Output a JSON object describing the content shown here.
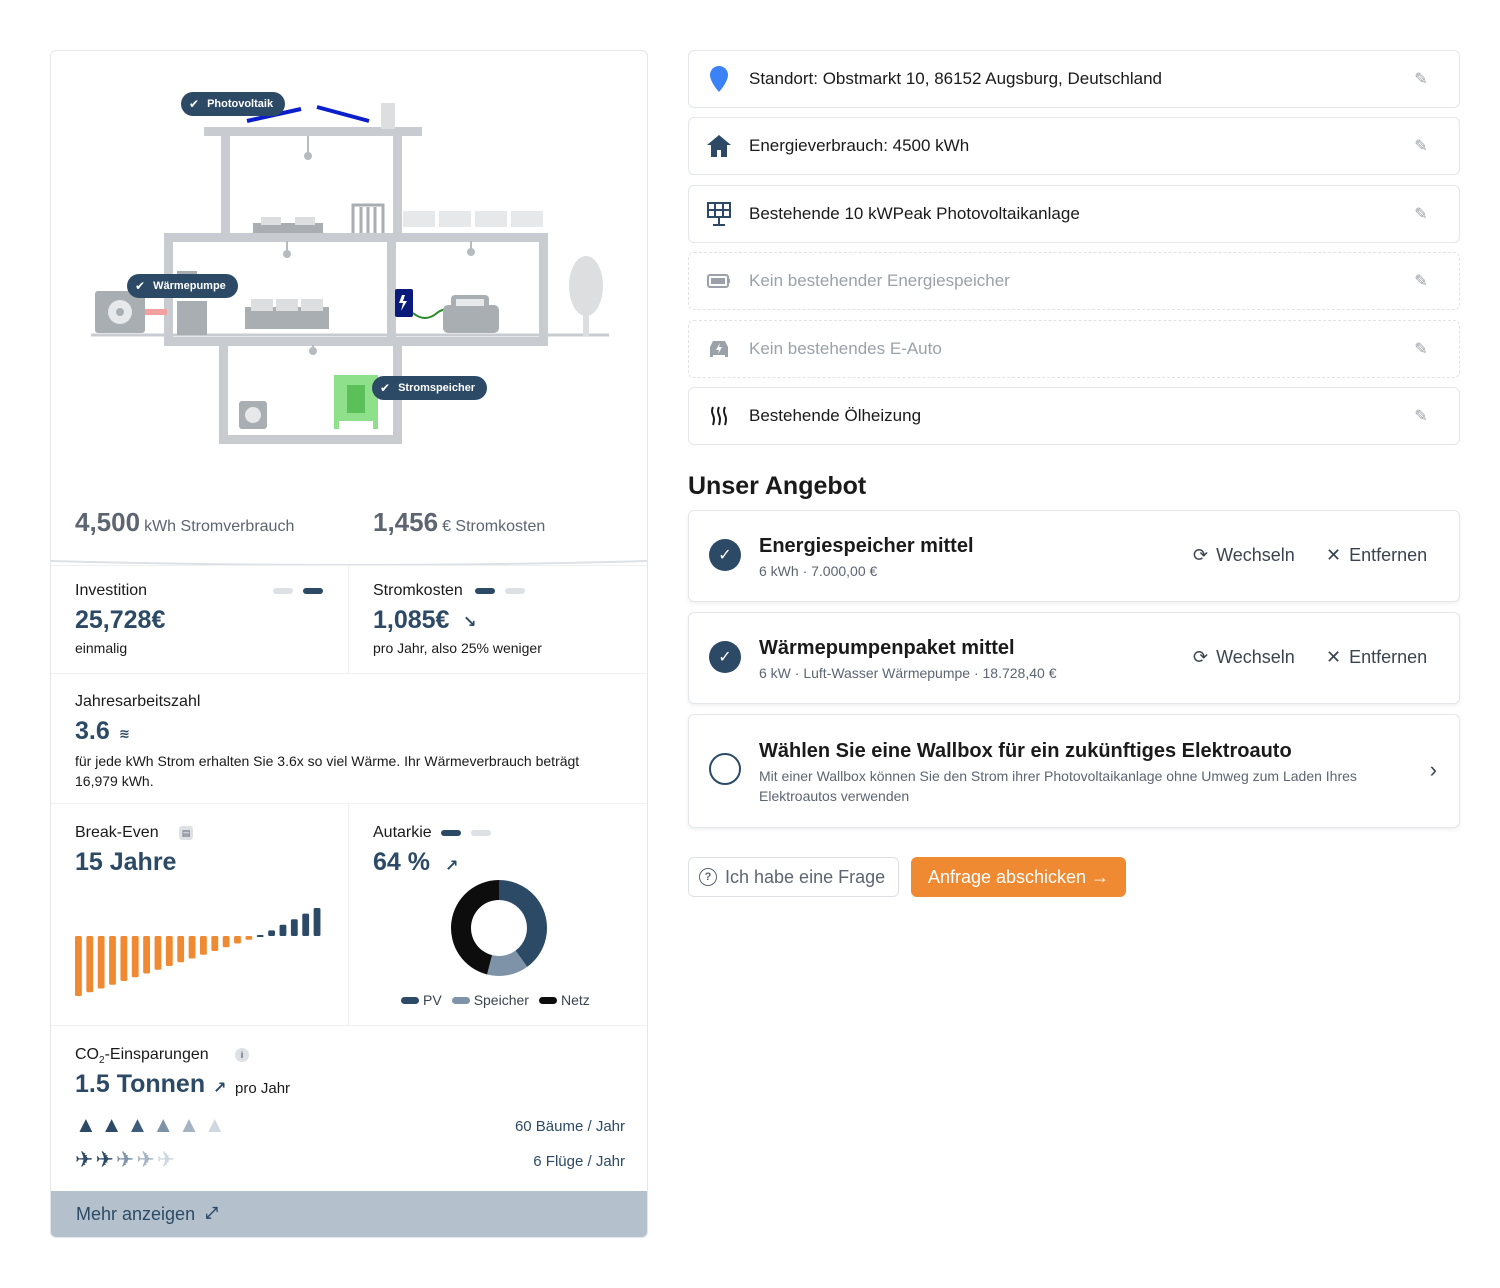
{
  "house": {
    "tags": {
      "photovoltaik": "Photovoltaik",
      "waermepumpe": "Wärmepumpe",
      "stromspeicher": "Stromspeicher"
    }
  },
  "top_stats": {
    "consumption_value": "4,500",
    "consumption_unit": "kWh Stromverbrauch",
    "cost_value": "1,456",
    "cost_unit": "€ Stromkosten"
  },
  "investition": {
    "label": "Investition",
    "value": "25,728€",
    "sub": "einmalig"
  },
  "stromkosten": {
    "label": "Stromkosten",
    "value": "1,085€",
    "sub": "pro Jahr, also 25% weniger"
  },
  "jaz": {
    "label": "Jahresarbeitszahl",
    "value": "3.6",
    "sub": "für jede kWh Strom erhalten Sie 3.6x so viel Wärme. Ihr Wärmeverbrauch beträgt 16,979 kWh."
  },
  "break_even": {
    "label": "Break-Even",
    "value": "15 Jahre"
  },
  "autarkie": {
    "label": "Autarkie",
    "value": "64 %",
    "legend": [
      "PV",
      "Speicher",
      "Netz"
    ]
  },
  "chart_data": [
    {
      "type": "bar",
      "values": [
        -16,
        -15,
        -14,
        -13,
        -12,
        -11,
        -10,
        -9,
        -8,
        -7,
        -6,
        -5,
        -4,
        -3,
        -2,
        -1,
        0,
        1,
        2,
        3,
        4,
        5
      ],
      "colors": {
        "negative": "#f08a32",
        "positive": "#2c4a66"
      }
    },
    {
      "type": "pie",
      "donut": true,
      "slices": [
        {
          "label": "PV",
          "value": 40,
          "color": "#2c4a66"
        },
        {
          "label": "Speicher",
          "value": 14,
          "color": "#7e93a8"
        },
        {
          "label": "Netz",
          "value": 46,
          "color": "#0d0d0d"
        }
      ]
    }
  ],
  "co2": {
    "label_main": "CO",
    "label_sub": "2",
    "label_rest": "-Einsparungen",
    "value": "1.5 Tonnen",
    "unit": "pro Jahr",
    "trees_text": "60 Bäume / Jahr",
    "flights_text": "6 Flüge / Jahr"
  },
  "more": {
    "label": "Mehr anzeigen"
  },
  "info_rows": [
    {
      "icon": "location-pin-icon",
      "text": "Standort: Obstmarkt 10, 86152 Augsburg, Deutschland",
      "muted": false
    },
    {
      "icon": "house-icon",
      "text": "Energieverbrauch: 4500 kWh",
      "muted": false
    },
    {
      "icon": "solar-panel-icon",
      "text": "Bestehende 10 kWPeak Photovoltaikanlage",
      "muted": false
    },
    {
      "icon": "battery-icon",
      "text": "Kein bestehender Energiespeicher",
      "muted": true
    },
    {
      "icon": "electric-car-icon",
      "text": "Kein bestehendes E-Auto",
      "muted": true
    },
    {
      "icon": "heating-icon",
      "text": "Bestehende Ölheizung",
      "muted": false
    }
  ],
  "offer_section": {
    "title": "Unser Angebot"
  },
  "offers": [
    {
      "title": "Energiespeicher mittel",
      "desc": "6 kWh · 7.000,00 €",
      "switch": "Wechseln",
      "remove": "Entfernen"
    },
    {
      "title": "Wärmepumpenpaket mittel",
      "desc": "6 kW · Luft-Wasser Wärmepumpe · 18.728,40 €",
      "switch": "Wechseln",
      "remove": "Entfernen"
    },
    {
      "title": "Wählen Sie eine Wallbox für ein zukünftiges Elektroauto",
      "desc": "Mit einer Wallbox können Sie den Strom ihrer Photovoltaikanlage ohne Umweg zum Laden Ihres Elektroautos verwenden"
    }
  ],
  "buttons": {
    "question": "Ich habe eine Frage",
    "send": "Anfrage abschicken →"
  },
  "colors": {
    "primary": "#2c4a66",
    "accent": "#f08a32",
    "muted": "#9aa1a9"
  }
}
